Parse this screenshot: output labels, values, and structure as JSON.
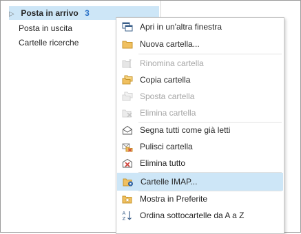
{
  "folders": {
    "inbox_label": "Posta in arrivo",
    "inbox_count": "3",
    "sent_label": "Posta in uscita",
    "search_folders_label": "Cartelle ricerche"
  },
  "menu": {
    "items": [
      {
        "label": "Apri in un'altra finestra",
        "icon": "open-window-icon",
        "enabled": true
      },
      {
        "label": "Nuova cartella...",
        "icon": "new-folder-icon",
        "enabled": true
      },
      {
        "label": "Rinomina cartella",
        "icon": "rename-folder-icon",
        "enabled": false
      },
      {
        "label": "Copia cartella",
        "icon": "copy-folder-icon",
        "enabled": true
      },
      {
        "label": "Sposta cartella",
        "icon": "move-folder-icon",
        "enabled": false
      },
      {
        "label": "Elimina cartella",
        "icon": "delete-folder-icon",
        "enabled": false
      },
      {
        "label": "Segna tutti come già letti",
        "icon": "mark-read-icon",
        "enabled": true
      },
      {
        "label": "Pulisci cartella",
        "icon": "clean-folder-icon",
        "enabled": true
      },
      {
        "label": "Elimina tutto",
        "icon": "delete-all-icon",
        "enabled": true
      },
      {
        "label": "Cartelle IMAP...",
        "icon": "imap-folders-icon",
        "enabled": true,
        "highlighted": true
      },
      {
        "label": "Mostra in Preferite",
        "icon": "favorites-star-icon",
        "enabled": true
      },
      {
        "label": "Ordina sottocartelle da A a Z",
        "icon": "sort-az-icon",
        "enabled": true
      }
    ]
  },
  "colors": {
    "selection": "#cde6f7",
    "count_blue": "#2a72c8",
    "folder_yellow": "#f0c060",
    "disabled_text": "#a6a6a6"
  }
}
